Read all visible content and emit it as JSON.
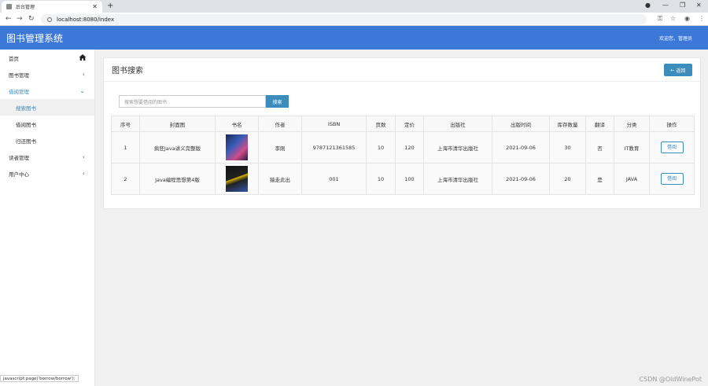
{
  "browser": {
    "tab_title": "后台管理",
    "url": "localhost:8080/index"
  },
  "header": {
    "app_title": "图书管理系统",
    "welcome": "欢迎您，管理员"
  },
  "sidebar": {
    "items": [
      {
        "label": "首页"
      },
      {
        "label": "图书管理"
      },
      {
        "label": "借阅管理"
      },
      {
        "label": "搜索图书"
      },
      {
        "label": "借阅图书"
      },
      {
        "label": "归还图书"
      },
      {
        "label": "读者管理"
      },
      {
        "label": "用户中心"
      }
    ]
  },
  "main": {
    "title": "图书搜索",
    "back_label": "返回",
    "search_placeholder": "搜索想要借阅的图书",
    "search_button": "搜索",
    "columns": [
      "序号",
      "封面图",
      "书名",
      "作者",
      "ISBN",
      "页数",
      "定价",
      "出版社",
      "出版时间",
      "库存数量",
      "翻译",
      "分类",
      "操作"
    ],
    "rows": [
      {
        "no": "1",
        "cover_caption": "疯狂Java讲义完整版",
        "author": "李刚",
        "isbn": "9787121361585",
        "pages": "10",
        "price": "120",
        "publisher": "上海市清华出版社",
        "pub_date": "2021-09-06",
        "stock": "30",
        "translated": "否",
        "category": "IT教育",
        "action": "借阅"
      },
      {
        "no": "2",
        "cover_caption": "Java编程思想第4版",
        "author": "猿走此出",
        "isbn": "001",
        "pages": "10",
        "price": "100",
        "publisher": "上海市清华出版社",
        "pub_date": "2021-09-06",
        "stock": "20",
        "translated": "是",
        "category": "JAVA",
        "action": "借阅"
      }
    ]
  },
  "statusbar": "javascript:page('borrow/borrow');",
  "watermark": "CSDN @OldWinePot"
}
